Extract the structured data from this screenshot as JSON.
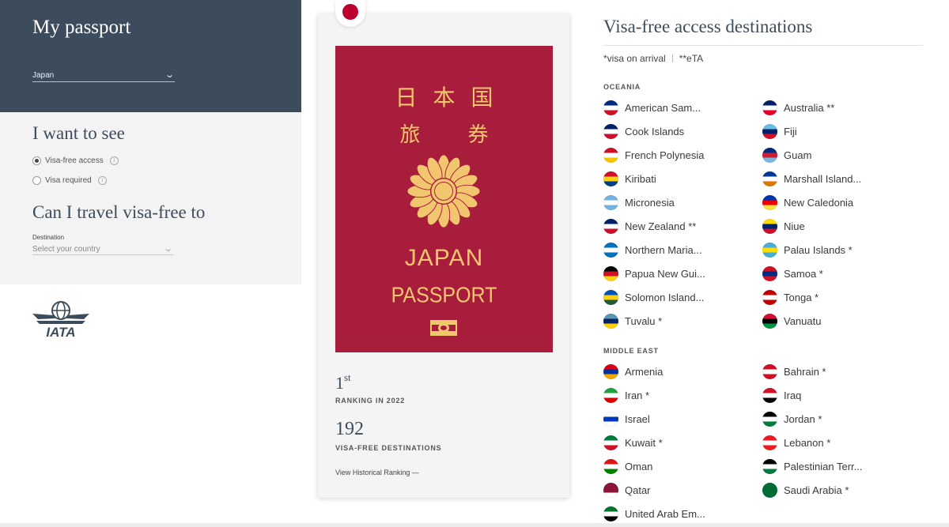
{
  "sidebar": {
    "title": "My passport",
    "country_value": "Japan",
    "want_heading": "I want to see",
    "radio_visa_free": "Visa-free access",
    "radio_visa_required": "Visa required",
    "travel_heading": "Can I travel visa-free to",
    "destination_label": "Destination",
    "destination_placeholder": "Select your country",
    "logo_text": "IATA"
  },
  "passport": {
    "kanji_line1": "日本国",
    "kanji_line2": "旅券",
    "title": "JAPAN",
    "subtitle": "PASSPORT",
    "rank": "1",
    "rank_suffix": "st",
    "rank_caption": "RANKING IN 2022",
    "destinations_count": "192",
    "destinations_caption": "VISA-FREE DESTINATIONS",
    "history_link": "View Historical Ranking —"
  },
  "destinations": {
    "title": "Visa-free access destinations",
    "legend_voa": "*visa on arrival",
    "legend_eta": "**eTA",
    "oceania_label": "OCEANIA",
    "middle_east_label": "MIDDLE EAST",
    "oceania": [
      {
        "name": "American Sam...",
        "flag": "american-samoa",
        "colors": [
          "#002b7f",
          "#ffffff",
          "#ce1126"
        ]
      },
      {
        "name": "Australia **",
        "flag": "australia",
        "colors": [
          "#012169",
          "#ffffff",
          "#e4002b"
        ]
      },
      {
        "name": "Cook Islands",
        "flag": "cook-islands",
        "colors": [
          "#012169",
          "#ffffff",
          "#c8102e"
        ]
      },
      {
        "name": "Fiji",
        "flag": "fiji",
        "colors": [
          "#68bfe5",
          "#012169",
          "#ce1126"
        ]
      },
      {
        "name": "French Polynesia",
        "flag": "french-polynesia",
        "colors": [
          "#ce1126",
          "#ffffff",
          "#f7c400"
        ]
      },
      {
        "name": "Guam",
        "flag": "guam",
        "colors": [
          "#00297b",
          "#c62139",
          "#7ab8e0"
        ]
      },
      {
        "name": "Kiribati",
        "flag": "kiribati",
        "colors": [
          "#ce1126",
          "#fcd116",
          "#003f87"
        ]
      },
      {
        "name": "Marshall Island...",
        "flag": "marshall-islands",
        "colors": [
          "#003893",
          "#ffffff",
          "#dd7500"
        ]
      },
      {
        "name": "Micronesia",
        "flag": "micronesia",
        "colors": [
          "#75b2dd",
          "#ffffff",
          "#75b2dd"
        ]
      },
      {
        "name": "New Caledonia",
        "flag": "new-caledonia",
        "colors": [
          "#0035ad",
          "#e00",
          "#fae042"
        ]
      },
      {
        "name": "New Zealand **",
        "flag": "new-zealand",
        "colors": [
          "#012169",
          "#ffffff",
          "#c8102e"
        ]
      },
      {
        "name": "Niue",
        "flag": "niue",
        "colors": [
          "#fedd00",
          "#012169",
          "#c8102e"
        ]
      },
      {
        "name": "Northern Maria...",
        "flag": "northern-mariana-islands",
        "colors": [
          "#0071bc",
          "#ffffff",
          "#0071bc"
        ]
      },
      {
        "name": "Palau Islands *",
        "flag": "palau",
        "colors": [
          "#4aadd6",
          "#ffde00",
          "#4aadd6"
        ]
      },
      {
        "name": "Papua New Gui...",
        "flag": "papua-new-guinea",
        "colors": [
          "#000000",
          "#ce1126",
          "#fcd116"
        ]
      },
      {
        "name": "Samoa *",
        "flag": "samoa",
        "colors": [
          "#ce1126",
          "#002b7f",
          "#ce1126"
        ]
      },
      {
        "name": "Solomon Island...",
        "flag": "solomon-islands",
        "colors": [
          "#0051ba",
          "#fcd116",
          "#215b33"
        ]
      },
      {
        "name": "Tonga *",
        "flag": "tonga",
        "colors": [
          "#c10000",
          "#ffffff",
          "#c10000"
        ]
      },
      {
        "name": "Tuvalu *",
        "flag": "tuvalu",
        "colors": [
          "#5b97b1",
          "#012169",
          "#ffce00"
        ]
      },
      {
        "name": "Vanuatu",
        "flag": "vanuatu",
        "colors": [
          "#d21034",
          "#000000",
          "#009543"
        ]
      }
    ],
    "middle_east": [
      {
        "name": "Armenia",
        "flag": "armenia",
        "colors": [
          "#d90012",
          "#0033a0",
          "#f2a800"
        ]
      },
      {
        "name": "Bahrain *",
        "flag": "bahrain",
        "colors": [
          "#ce1126",
          "#ffffff",
          "#ce1126"
        ]
      },
      {
        "name": "Iran *",
        "flag": "iran",
        "colors": [
          "#239f40",
          "#ffffff",
          "#da0000"
        ]
      },
      {
        "name": "Iraq",
        "flag": "iraq",
        "colors": [
          "#ce1126",
          "#ffffff",
          "#000000"
        ]
      },
      {
        "name": "Israel",
        "flag": "israel",
        "colors": [
          "#ffffff",
          "#0038b8",
          "#ffffff"
        ]
      },
      {
        "name": "Jordan *",
        "flag": "jordan",
        "colors": [
          "#000000",
          "#ffffff",
          "#007a3d"
        ]
      },
      {
        "name": "Kuwait *",
        "flag": "kuwait",
        "colors": [
          "#007a3d",
          "#ffffff",
          "#ce1126"
        ]
      },
      {
        "name": "Lebanon *",
        "flag": "lebanon",
        "colors": [
          "#ed1c24",
          "#ffffff",
          "#ed1c24"
        ]
      },
      {
        "name": "Oman",
        "flag": "oman",
        "colors": [
          "#db161b",
          "#ffffff",
          "#008000"
        ]
      },
      {
        "name": "Palestinian Terr...",
        "flag": "palestine",
        "colors": [
          "#000000",
          "#ffffff",
          "#007a3d"
        ]
      },
      {
        "name": "Qatar",
        "flag": "qatar",
        "colors": [
          "#8a1538",
          "#8a1538",
          "#ffffff"
        ]
      },
      {
        "name": "Saudi Arabia *",
        "flag": "saudi-arabia",
        "colors": [
          "#006c35",
          "#006c35",
          "#006c35"
        ]
      },
      {
        "name": "United Arab Em...",
        "flag": "united-arab-emirates",
        "colors": [
          "#00732f",
          "#ffffff",
          "#000000"
        ]
      }
    ]
  }
}
